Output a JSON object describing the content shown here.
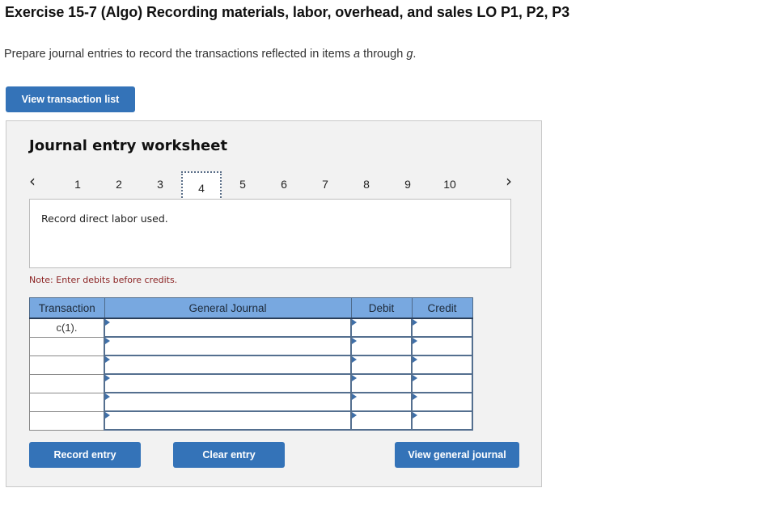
{
  "header": {
    "title": "Exercise 15-7 (Algo) Recording materials, labor, overhead, and sales LO P1, P2, P3",
    "instruction_prefix": "Prepare journal entries to record the transactions reflected in items ",
    "instruction_a": "a",
    "instruction_mid": " through ",
    "instruction_g": "g",
    "instruction_suffix": "."
  },
  "buttons": {
    "view_transaction_list": "View transaction list",
    "record_entry": "Record entry",
    "clear_entry": "Clear entry",
    "view_general_journal": "View general journal"
  },
  "worksheet": {
    "title": "Journal entry worksheet",
    "pages": [
      "1",
      "2",
      "3",
      "4",
      "5",
      "6",
      "7",
      "8",
      "9",
      "10"
    ],
    "active_page": "4",
    "prev_icon": "‹",
    "next_icon": "›",
    "description": "Record direct labor used.",
    "note": "Note: Enter debits before credits."
  },
  "journal": {
    "headers": {
      "transaction": "Transaction",
      "general_journal": "General Journal",
      "debit": "Debit",
      "credit": "Credit"
    },
    "rows": [
      {
        "transaction": "c(1).",
        "account": "",
        "debit": "",
        "credit": ""
      },
      {
        "transaction": "",
        "account": "",
        "debit": "",
        "credit": ""
      },
      {
        "transaction": "",
        "account": "",
        "debit": "",
        "credit": ""
      },
      {
        "transaction": "",
        "account": "",
        "debit": "",
        "credit": ""
      },
      {
        "transaction": "",
        "account": "",
        "debit": "",
        "credit": ""
      },
      {
        "transaction": "",
        "account": "",
        "debit": "",
        "credit": ""
      }
    ]
  }
}
